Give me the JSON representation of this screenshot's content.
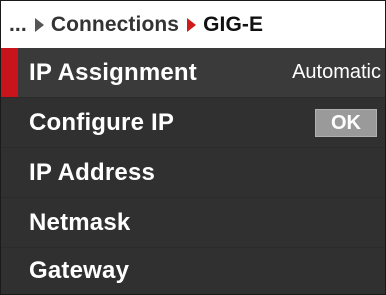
{
  "breadcrumb": {
    "ellipsis": "...",
    "parent": "Connections",
    "current": "GIG-E"
  },
  "menu": {
    "items": [
      {
        "label": "IP Assignment",
        "value": "Automatic",
        "selected": true
      },
      {
        "label": "Configure IP",
        "button": "OK"
      },
      {
        "label": "IP Address"
      },
      {
        "label": "Netmask"
      },
      {
        "label": "Gateway"
      }
    ]
  },
  "colors": {
    "accent": "#c8141b",
    "row_background": "#303030",
    "button_background": "#9a9a9a"
  }
}
